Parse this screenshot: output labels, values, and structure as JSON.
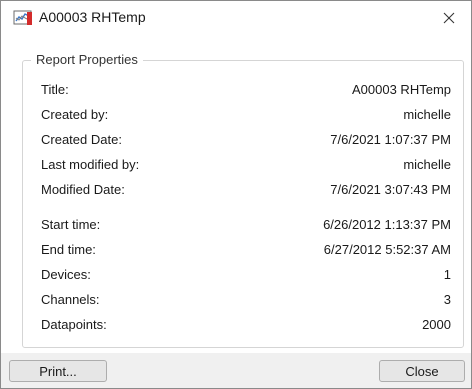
{
  "window": {
    "title": "A00003 RHTemp",
    "icon": "report-chart-icon",
    "close_glyph": "close-icon"
  },
  "group": {
    "legend": "Report Properties"
  },
  "properties": [
    {
      "label": "Title:",
      "value": "A00003 RHTemp"
    },
    {
      "label": "Created by:",
      "value": "michelle"
    },
    {
      "label": "Created Date:",
      "value": "7/6/2021 1:07:37 PM"
    },
    {
      "label": "Last modified by:",
      "value": "michelle"
    },
    {
      "label": "Modified Date:",
      "value": "7/6/2021 3:07:43 PM"
    },
    {
      "label": "Start time:",
      "value": "6/26/2012 1:13:37 PM"
    },
    {
      "label": "End time:",
      "value": "6/27/2012 5:52:37 AM"
    },
    {
      "label": "Devices:",
      "value": "1"
    },
    {
      "label": "Channels:",
      "value": "3"
    },
    {
      "label": "Datapoints:",
      "value": "2000"
    }
  ],
  "buttons": {
    "print_label": "Print...",
    "close_label": "Close"
  },
  "colors": {
    "icon_red": "#d32b2b",
    "icon_blue": "#3c78c8",
    "border": "#d5d5d5",
    "button_face": "#e6e6e6"
  }
}
